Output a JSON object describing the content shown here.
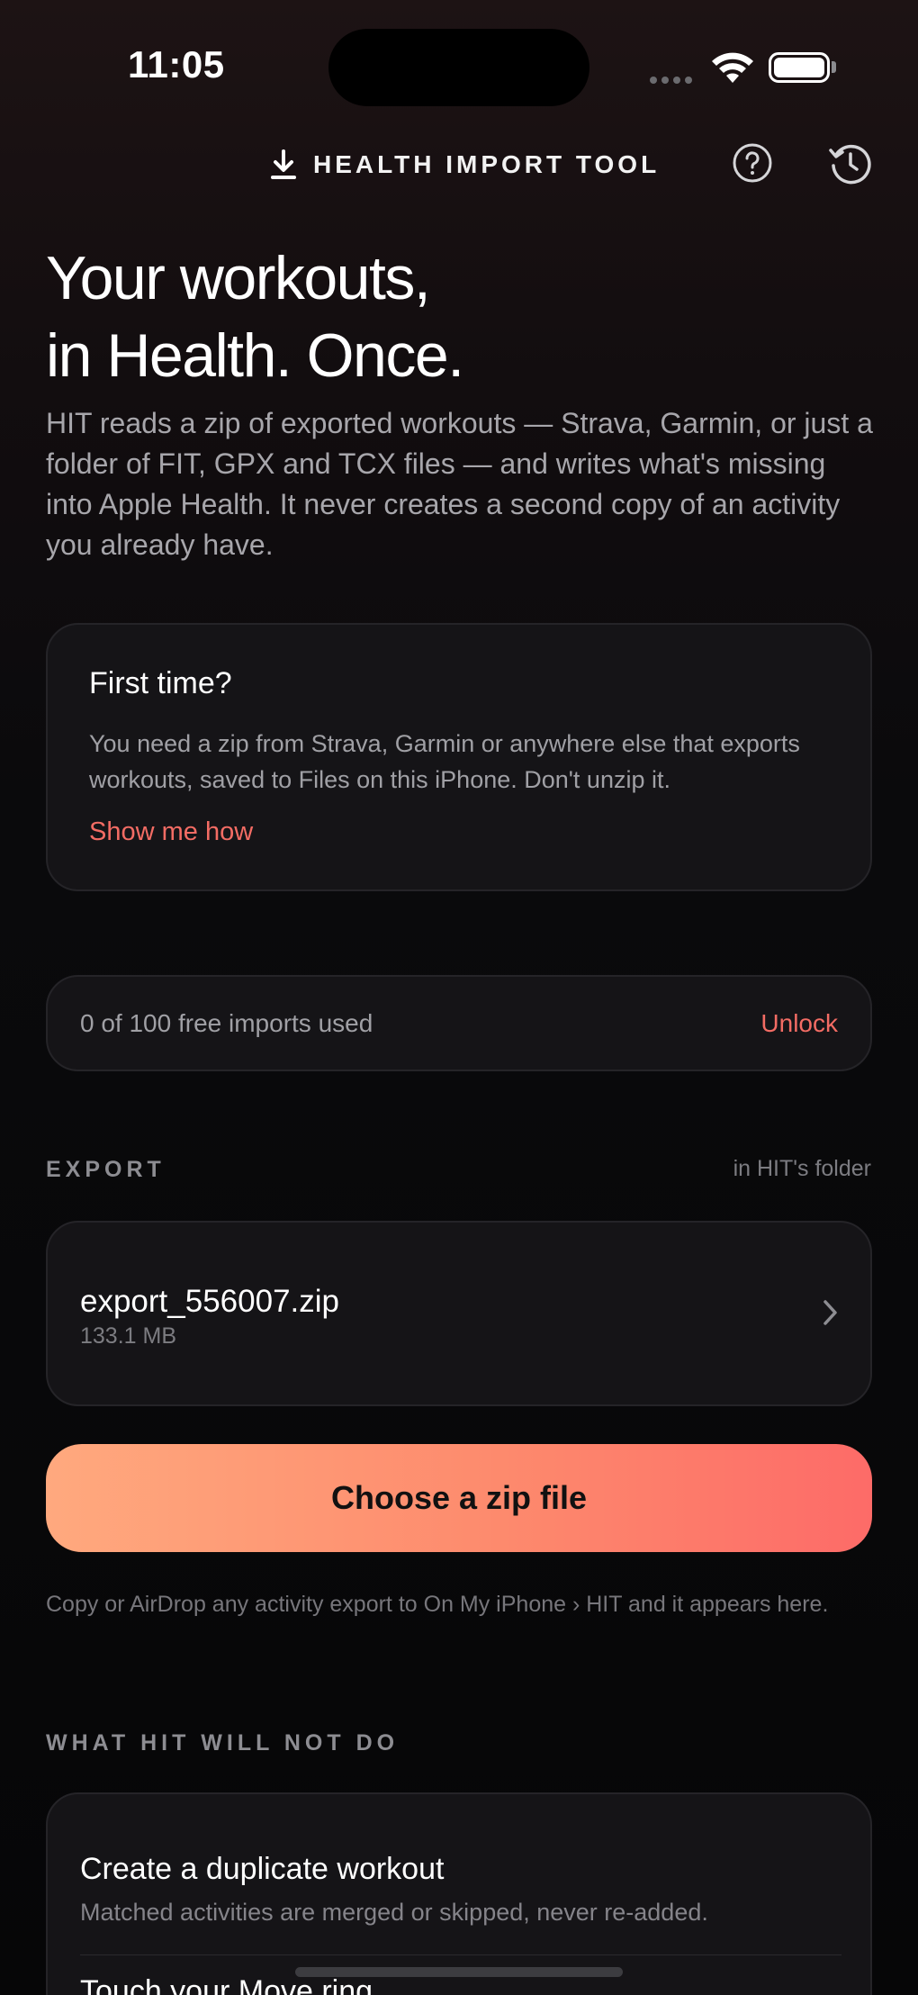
{
  "status_bar": {
    "time": "11:05"
  },
  "header": {
    "title": "HEALTH IMPORT TOOL",
    "icons": [
      "download-icon",
      "help-icon",
      "history-icon"
    ]
  },
  "hero": {
    "title_line1": "Your workouts,",
    "title_line2": "in Health. Once.",
    "body": "HIT reads a zip of exported workouts — Strava, Garmin, or just a folder of FIT, GPX and TCX files — and writes what's missing into Apple Health. It never creates a second copy of an activity you already have."
  },
  "first_time": {
    "title": "First time?",
    "body": "You need a zip from Strava, Garmin or anywhere else that exports workouts, saved to Files on this iPhone. Don't unzip it.",
    "link": "Show me how"
  },
  "quota": {
    "text": "0 of 100 free imports used",
    "unlock_label": "Unlock"
  },
  "export": {
    "label": "EXPORT",
    "note": "in HIT's folder",
    "file_name": "export_556007.zip",
    "file_size": "133.1 MB"
  },
  "choose_button": "Choose a zip file",
  "help_note": "Copy or AirDrop any activity export to On My iPhone › HIT and it appears here.",
  "wont_do": {
    "label": "WHAT HIT WILL NOT DO",
    "items": [
      {
        "title": "Create a duplicate workout",
        "desc": "Matched activities are merged or skipped, never re-added."
      },
      {
        "title": "Touch your Move ring",
        "desc": ""
      }
    ]
  },
  "colors": {
    "accent": "#f36c64",
    "button_gradient_start": "#ffa97e",
    "button_gradient_end": "#fd6b68",
    "card_bg": "#151417"
  }
}
